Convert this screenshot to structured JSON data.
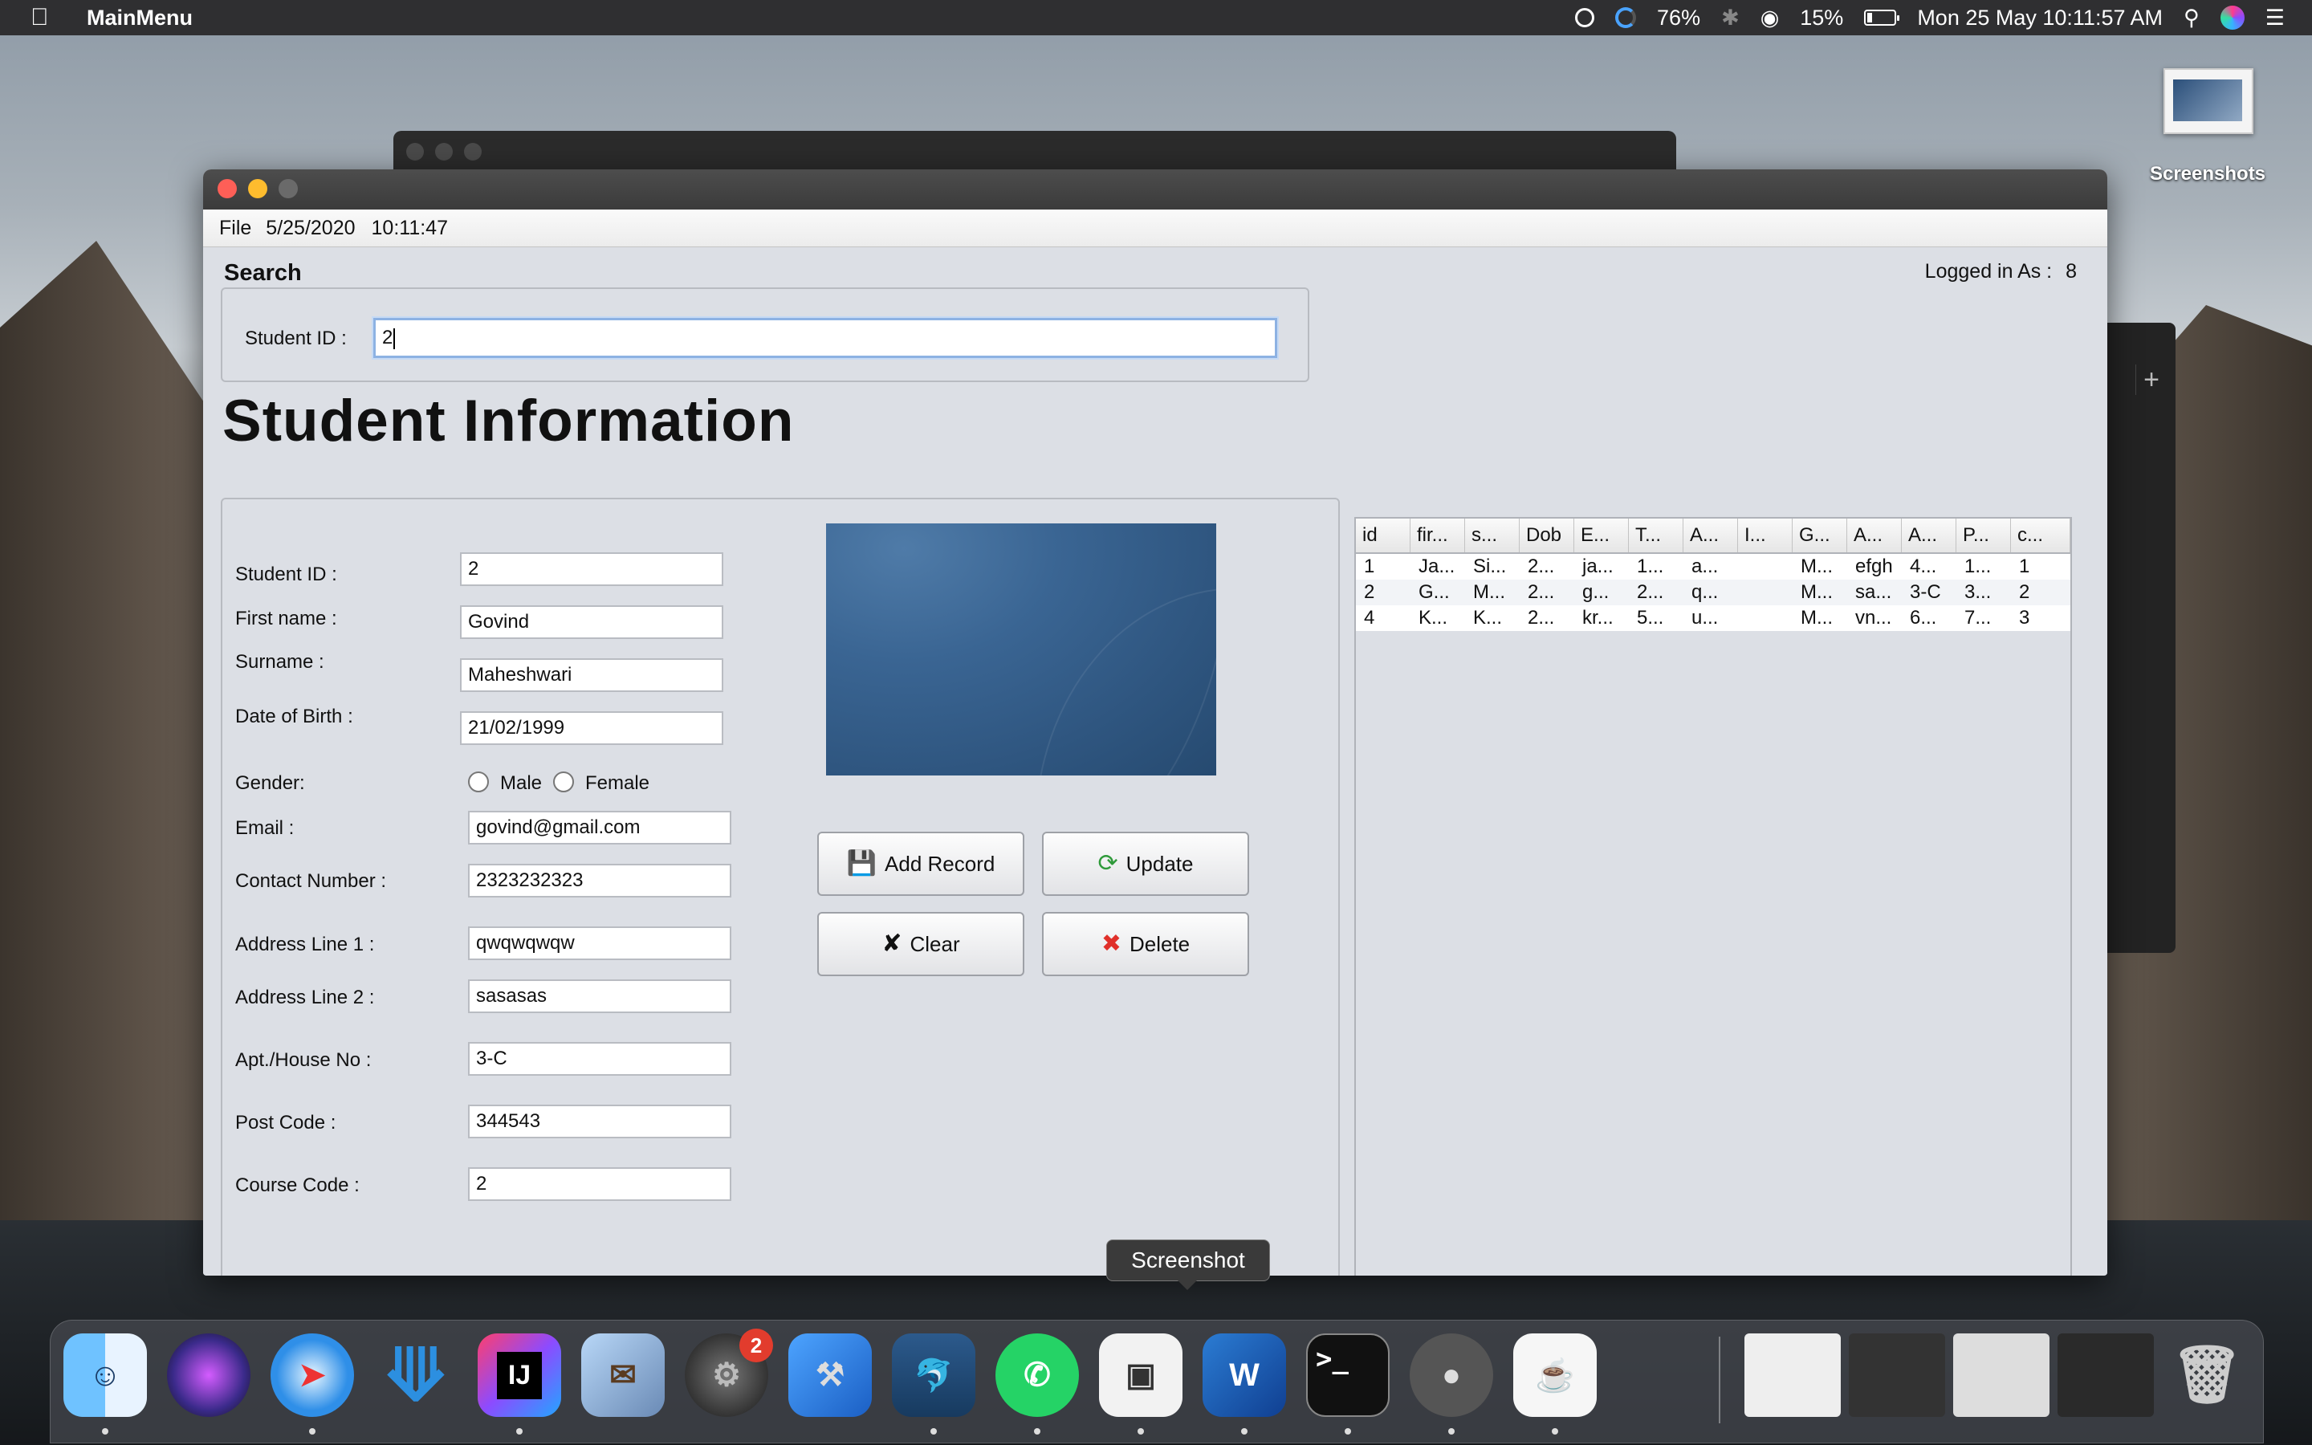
{
  "menubar": {
    "app_name": "MainMenu",
    "battery_circle_pct": "76%",
    "battery_pct": "15%",
    "datetime": "Mon 25 May  10:11:57 AM"
  },
  "desktop": {
    "screenshots_label": "Screenshots"
  },
  "window": {
    "menu": {
      "file": "File",
      "date": "5/25/2020",
      "time": "10:11:47"
    },
    "logged_in": {
      "label": "Logged in As :",
      "value": "8"
    },
    "search": {
      "title": "Search",
      "student_id_label": "Student ID :",
      "student_id_value": "2"
    },
    "title": "Student Information",
    "form": {
      "student_id": {
        "label": "Student ID :",
        "value": "2"
      },
      "first_name": {
        "label": "First name :",
        "value": "Govind"
      },
      "surname": {
        "label": "Surname :",
        "value": "Maheshwari"
      },
      "dob": {
        "label": "Date of Birth :",
        "value": "21/02/1999"
      },
      "gender": {
        "label": "Gender:",
        "male": "Male",
        "female": "Female"
      },
      "email": {
        "label": "Email :",
        "value": "govind@gmail.com"
      },
      "contact": {
        "label": "Contact Number :",
        "value": "2323232323"
      },
      "address1": {
        "label": "Address Line 1 :",
        "value": "qwqwqwqw"
      },
      "address2": {
        "label": "Address Line 2 :",
        "value": "sasasas"
      },
      "apt": {
        "label": "Apt./House No :",
        "value": "3-C"
      },
      "postcode": {
        "label": "Post Code :",
        "value": "344543"
      },
      "course": {
        "label": "Course Code :",
        "value": "2"
      }
    },
    "buttons": {
      "add": "Add Record",
      "update": "Update",
      "clear": "Clear",
      "delete": "Delete"
    },
    "table": {
      "columns": [
        "id",
        "fir...",
        "s...",
        "Dob",
        "E...",
        "T...",
        "A...",
        "I...",
        "G...",
        "A...",
        "A...",
        "P...",
        "c..."
      ],
      "rows": [
        [
          "1",
          "Ja...",
          "Si...",
          "2...",
          "ja...",
          "1...",
          "a...",
          "",
          "M...",
          "efgh",
          "4...",
          "1...",
          "1"
        ],
        [
          "2",
          "G...",
          "M...",
          "2...",
          "g...",
          "2...",
          "q...",
          "",
          "M...",
          "sa...",
          "3-C",
          "3...",
          "2"
        ],
        [
          "4",
          "K...",
          "K...",
          "2...",
          "kr...",
          "5...",
          "u...",
          "",
          "M...",
          "vn...",
          "6...",
          "7...",
          "3"
        ]
      ]
    }
  },
  "tooltip": "Screenshot",
  "dock": {
    "items": [
      "finder-icon",
      "siri-icon",
      "safari-icon",
      "vscode-icon",
      "intellij-icon",
      "mail-icon",
      "system-preferences-icon",
      "xcode-icon",
      "mysql-workbench-icon",
      "whatsapp-icon",
      "screenshot-icon",
      "word-icon",
      "terminal-icon",
      "mamp-icon",
      "java-icon"
    ],
    "system_prefs_badge": "2",
    "intellij_text": "IJ",
    "word_text": "W",
    "terminal_text": ">_"
  }
}
